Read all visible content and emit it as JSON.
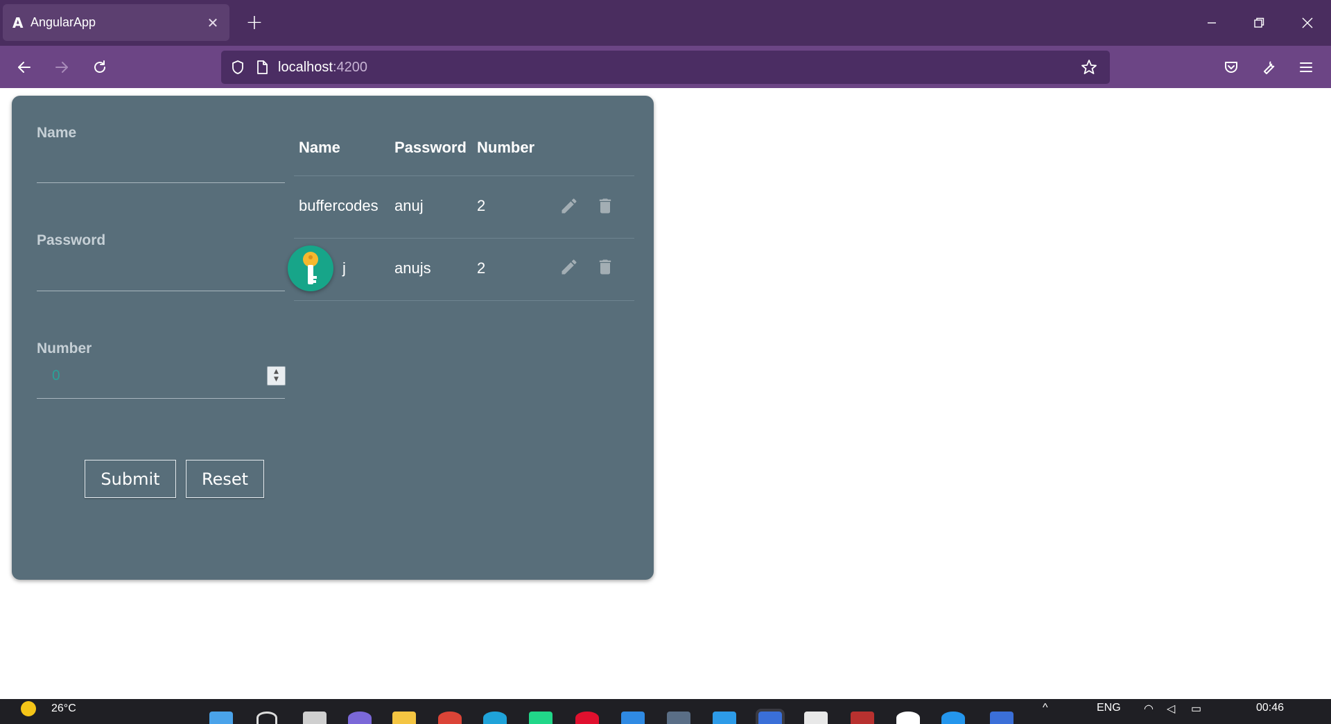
{
  "browser": {
    "tab": {
      "favicon": "A",
      "title": "AngularApp",
      "close": "✕"
    },
    "new_tab": "+",
    "url": {
      "host": "localhost",
      "port": ":4200"
    }
  },
  "form": {
    "name_label": "Name",
    "name_value": "",
    "password_label": "Password",
    "password_value": "",
    "number_label": "Number",
    "number_value": "0",
    "submit_label": "Submit",
    "reset_label": "Reset"
  },
  "table": {
    "headers": [
      "Name",
      "Password",
      "Number"
    ],
    "rows": [
      {
        "name": "buffercodes",
        "password": "anuj",
        "number": "2"
      },
      {
        "name": "j",
        "password": "anujs",
        "number": "2"
      }
    ]
  },
  "taskbar": {
    "temperature": "26°C",
    "language": "ENG",
    "time": "00:46"
  },
  "colors": {
    "tabstrip": "#4a2d5f",
    "navbar": "#6c4585",
    "card": "#586e7a",
    "key_badge": "#17a589"
  },
  "icons": [
    "back-icon",
    "forward-icon",
    "reload-icon",
    "shield-icon",
    "page-icon",
    "star-icon",
    "pocket-icon",
    "wrench-icon",
    "menu-icon",
    "edit-icon",
    "delete-icon",
    "key-icon"
  ]
}
